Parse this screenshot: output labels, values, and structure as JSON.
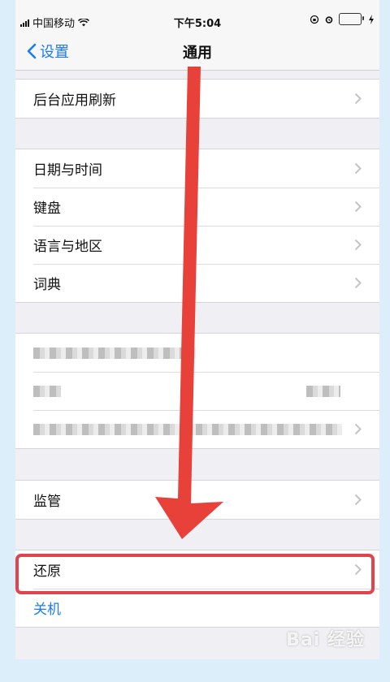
{
  "status_bar": {
    "carrier": "中国移动",
    "time": "下午5:04"
  },
  "nav": {
    "back_label": "设置",
    "title": "通用"
  },
  "groups": {
    "refresh": {
      "items": [
        {
          "label": "后台应用刷新"
        }
      ]
    },
    "locale": {
      "items": [
        {
          "label": "日期与时间"
        },
        {
          "label": "键盘"
        },
        {
          "label": "语言与地区"
        },
        {
          "label": "词典"
        }
      ]
    },
    "supervision": {
      "items": [
        {
          "label": "监管"
        }
      ]
    },
    "reset": {
      "items": [
        {
          "label": "还原",
          "highlighted": true
        },
        {
          "label": "关机"
        }
      ]
    }
  },
  "colors": {
    "accent_blue": "#1a7cf5",
    "highlight_red": "#e0454f",
    "arrow_red": "#e8413a",
    "battery_green": "#4cd964"
  },
  "watermark": "Bai 经验"
}
